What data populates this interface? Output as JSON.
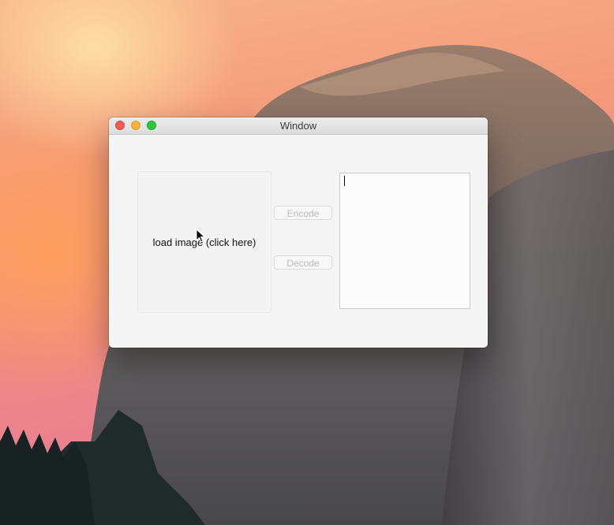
{
  "window": {
    "title": "Window"
  },
  "image_well": {
    "label": "load image (click here)"
  },
  "buttons": {
    "encode_label": "Encode",
    "decode_label": "Decode"
  },
  "text_area": {
    "value": ""
  },
  "colors": {
    "close": "#ee5e56",
    "minimize": "#f6b33c",
    "maximize": "#2dc840",
    "disabled_text": "#b9b9b9"
  },
  "icons": {
    "cursor": "arrow-pointer-icon",
    "text_caret": "text-caret-icon"
  }
}
